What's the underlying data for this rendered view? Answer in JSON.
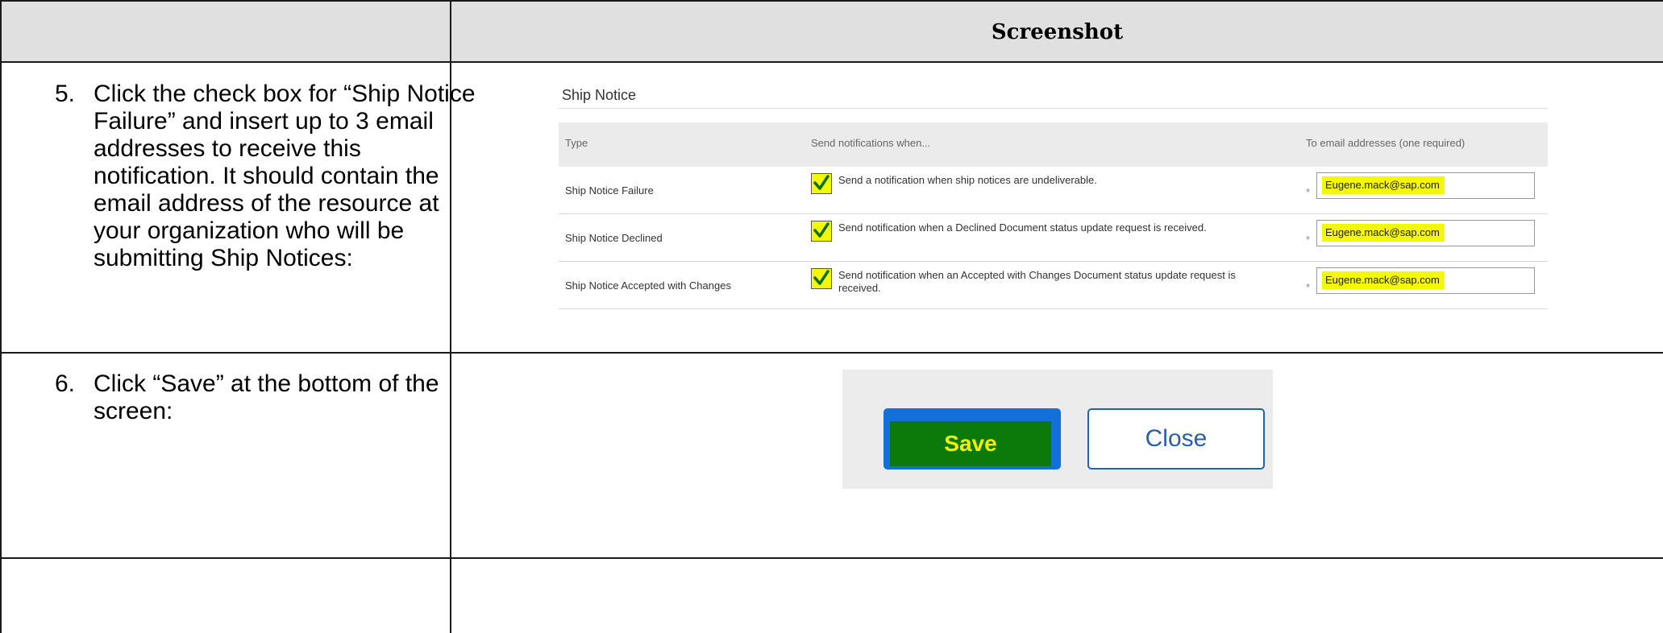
{
  "header": {
    "title": "Screenshot"
  },
  "steps": [
    {
      "number": "5.",
      "text": "Click the check box for “Ship Notice Failure” and insert up to 3 email addresses to receive this notification. It should contain the email address of the resource at your organization who will be submitting Ship Notices:"
    },
    {
      "number": "6.",
      "text": "Click “Save” at the bottom of the screen:"
    }
  ],
  "ship_notice": {
    "title": "Ship Notice",
    "columns": {
      "type": "Type",
      "send": "Send notifications when...",
      "email": "To email addresses (one required)"
    },
    "rows": [
      {
        "type": "Ship Notice Failure",
        "checked": true,
        "description": "Send a notification when ship notices are undeliverable.",
        "required_mark": "*",
        "email": "Eugene.mack@sap.com"
      },
      {
        "type": "Ship Notice Declined",
        "checked": true,
        "description": "Send notification when a Declined Document status update request is received.",
        "required_mark": "*",
        "email": "Eugene.mack@sap.com"
      },
      {
        "type": "Ship Notice Accepted with Changes",
        "checked": true,
        "description": "Send notification when an Accepted with Changes Document status update request is received.",
        "required_mark": "*",
        "email": "Eugene.mack@sap.com"
      }
    ],
    "highlight_color": "#f4f800",
    "check_icon": "checkmark-icon"
  },
  "buttons": {
    "save_label": "Save",
    "close_label": "Close",
    "save_color": "#1270d8",
    "save_highlight_color": "#0b7a0b"
  }
}
